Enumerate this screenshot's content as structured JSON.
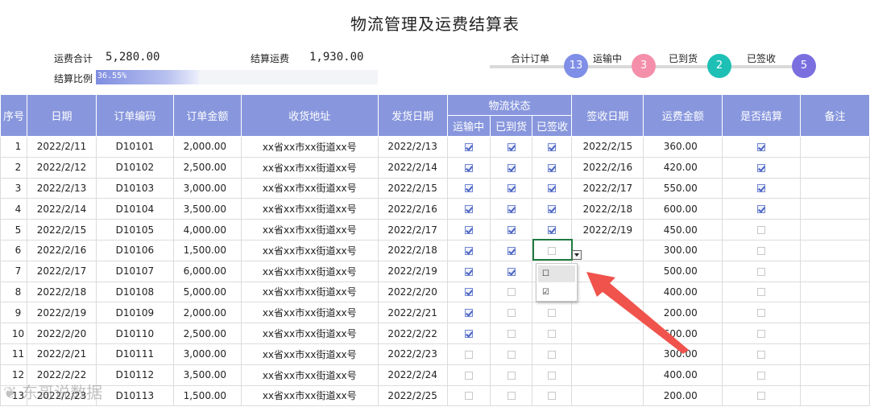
{
  "title": "物流管理及运费结算表",
  "summary": {
    "total_freight_label": "运费合计",
    "total_freight_value": "5,280.00",
    "settled_freight_label": "结算运费",
    "settled_freight_value": "1,930.00",
    "ratio_label": "结算比例",
    "ratio_text": "36.55%",
    "ratio_fraction": 0.3655
  },
  "stages": [
    {
      "label": "合计订单",
      "count": "13",
      "color": "#7f8ee6"
    },
    {
      "label": "运输中",
      "count": "3",
      "color": "#f58fa9"
    },
    {
      "label": "已到货",
      "count": "2",
      "color": "#1ec0b5"
    },
    {
      "label": "已签收",
      "count": "5",
      "color": "#7b6fe0"
    }
  ],
  "table": {
    "headers": {
      "seq": "序号",
      "date": "日期",
      "order_no": "订单编码",
      "amount": "订单金额",
      "address": "收货地址",
      "ship_date": "发货日期",
      "logistics_status": "物流状态",
      "in_transit": "运输中",
      "arrived": "已到货",
      "signed": "已签收",
      "sign_date": "签收日期",
      "freight": "运费金额",
      "settled": "是否结算",
      "remark": "备注"
    },
    "rows": [
      {
        "seq": "1",
        "date": "2022/2/11",
        "order": "D10101",
        "amount": "2,000.00",
        "addr": "xx省xx市xx街道xx号",
        "ship": "2022/2/13",
        "transit": true,
        "arrived": true,
        "signed": true,
        "sign_date": "2022/2/15",
        "freight": "360.00",
        "settled": true,
        "remark": ""
      },
      {
        "seq": "2",
        "date": "2022/2/12",
        "order": "D10102",
        "amount": "2,500.00",
        "addr": "xx省xx市xx街道xx号",
        "ship": "2022/2/14",
        "transit": true,
        "arrived": true,
        "signed": true,
        "sign_date": "2022/2/16",
        "freight": "420.00",
        "settled": true,
        "remark": ""
      },
      {
        "seq": "3",
        "date": "2022/2/13",
        "order": "D10103",
        "amount": "3,000.00",
        "addr": "xx省xx市xx街道xx号",
        "ship": "2022/2/15",
        "transit": true,
        "arrived": true,
        "signed": true,
        "sign_date": "2022/2/17",
        "freight": "550.00",
        "settled": true,
        "remark": ""
      },
      {
        "seq": "4",
        "date": "2022/2/14",
        "order": "D10104",
        "amount": "3,500.00",
        "addr": "xx省xx市xx街道xx号",
        "ship": "2022/2/16",
        "transit": true,
        "arrived": true,
        "signed": true,
        "sign_date": "2022/2/18",
        "freight": "600.00",
        "settled": true,
        "remark": ""
      },
      {
        "seq": "5",
        "date": "2022/2/15",
        "order": "D10105",
        "amount": "4,000.00",
        "addr": "xx省xx市xx街道xx号",
        "ship": "2022/2/17",
        "transit": true,
        "arrived": true,
        "signed": true,
        "sign_date": "2022/2/19",
        "freight": "450.00",
        "settled": false,
        "remark": ""
      },
      {
        "seq": "6",
        "date": "2022/2/16",
        "order": "D10106",
        "amount": "1,500.00",
        "addr": "xx省xx市xx街道xx号",
        "ship": "2022/2/18",
        "transit": true,
        "arrived": true,
        "signed": false,
        "sign_date": "",
        "freight": "300.00",
        "settled": false,
        "remark": ""
      },
      {
        "seq": "7",
        "date": "2022/2/17",
        "order": "D10107",
        "amount": "6,000.00",
        "addr": "xx省xx市xx街道xx号",
        "ship": "2022/2/19",
        "transit": true,
        "arrived": true,
        "signed": false,
        "sign_date": "",
        "freight": "500.00",
        "settled": false,
        "remark": ""
      },
      {
        "seq": "8",
        "date": "2022/2/18",
        "order": "D10108",
        "amount": "5,000.00",
        "addr": "xx省xx市xx街道xx号",
        "ship": "2022/2/20",
        "transit": true,
        "arrived": false,
        "signed": false,
        "sign_date": "",
        "freight": "400.00",
        "settled": false,
        "remark": ""
      },
      {
        "seq": "9",
        "date": "2022/2/19",
        "order": "D10109",
        "amount": "2,000.00",
        "addr": "xx省xx市xx街道xx号",
        "ship": "2022/2/21",
        "transit": true,
        "arrived": false,
        "signed": false,
        "sign_date": "",
        "freight": "200.00",
        "settled": false,
        "remark": ""
      },
      {
        "seq": "10",
        "date": "2022/2/20",
        "order": "D10110",
        "amount": "2,500.00",
        "addr": "xx省xx市xx街道xx号",
        "ship": "2022/2/22",
        "transit": true,
        "arrived": false,
        "signed": false,
        "sign_date": "",
        "freight": "600.00",
        "settled": false,
        "remark": ""
      },
      {
        "seq": "11",
        "date": "2022/2/21",
        "order": "D10111",
        "amount": "3,000.00",
        "addr": "xx省xx市xx街道xx号",
        "ship": "2022/2/23",
        "transit": false,
        "arrived": false,
        "signed": false,
        "sign_date": "",
        "freight": "300.00",
        "settled": false,
        "remark": ""
      },
      {
        "seq": "12",
        "date": "2022/2/22",
        "order": "D10112",
        "amount": "3,500.00",
        "addr": "xx省xx市xx街道xx号",
        "ship": "2022/2/24",
        "transit": false,
        "arrived": false,
        "signed": false,
        "sign_date": "",
        "freight": "400.00",
        "settled": false,
        "remark": ""
      },
      {
        "seq": "13",
        "date": "2022/2/23",
        "order": "D10113",
        "amount": "1,500.00",
        "addr": "xx省xx市xx街道xx号",
        "ship": "2022/2/25",
        "transit": false,
        "arrived": false,
        "signed": false,
        "sign_date": "",
        "freight": "200.00",
        "settled": false,
        "remark": ""
      }
    ]
  },
  "dropdown": {
    "options": [
      "☐",
      "☑"
    ],
    "highlighted_index": 0
  },
  "colors": {
    "header_bg": "#8897dd",
    "arrow": "#f0534c",
    "selection_border": "#1f7a3e"
  },
  "watermark": "❦ 东哥说数据"
}
